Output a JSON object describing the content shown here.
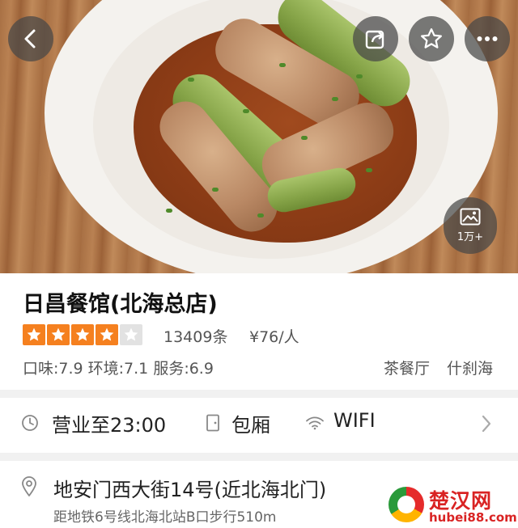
{
  "colors": {
    "star_active": "#f5801f",
    "star_inactive": "#e2e2e2",
    "watermark_red": "#d92323",
    "text_primary": "#111111",
    "text_secondary": "#555555"
  },
  "header": {
    "back_icon": "chevron-left-icon",
    "share_icon": "share-icon",
    "favorite_icon": "star-outline-icon",
    "more_icon": "more-dots-icon",
    "photo_icon": "image-icon",
    "photo_count": "1万+"
  },
  "restaurant": {
    "name": "日昌餐馆(北海总店)",
    "rating_stars": 4,
    "rating_max": 5,
    "review_count": "13409条",
    "price": "¥76/人",
    "scores": "口味:7.9 环境:7.1 服务:6.9",
    "categories": [
      "茶餐厅",
      "什刹海"
    ]
  },
  "facilities": {
    "hours": "营业至23:00",
    "private_room": "包厢",
    "wifi": "WIFI"
  },
  "address": {
    "line": "地安门西大街14号(近北海北门)",
    "subway": "距地铁6号线北海北站B口步行510m"
  },
  "watermark": {
    "cn": "楚汉网",
    "url": "hubei88.com"
  }
}
